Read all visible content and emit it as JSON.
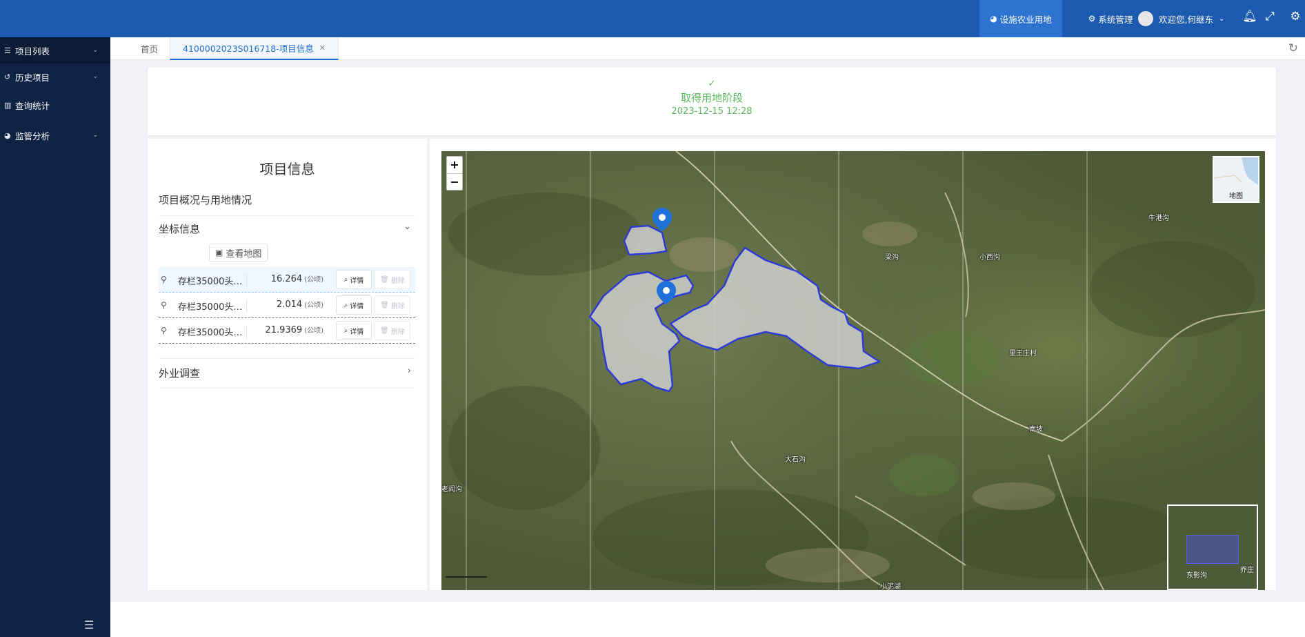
{
  "header": {
    "nav_active": "设施农业用地",
    "nav_system": "系统管理",
    "user_greeting": "欢迎您,何继东"
  },
  "sidebar": {
    "items": [
      {
        "label": "项目列表",
        "icon": "list-icon"
      },
      {
        "label": "历史项目",
        "icon": "history-icon"
      },
      {
        "label": "查询统计",
        "icon": "bar-chart-icon"
      },
      {
        "label": "监管分析",
        "icon": "pie-chart-icon"
      }
    ]
  },
  "tabs": {
    "home": "首页",
    "active": "4100002023S016718-项目信息"
  },
  "stage": {
    "name": "取得用地阶段",
    "time": "2023-12-15 12:28"
  },
  "panel": {
    "title": "项目信息",
    "section_overview": "项目概况与用地情况",
    "section_coords": "坐标信息",
    "map_button": "查看地图",
    "section_field": "外业调查",
    "detail_label": "详情",
    "delete_label": "删除",
    "unit": "(公顷)",
    "rows": [
      {
        "name": "存栏35000头…",
        "area": "16.264"
      },
      {
        "name": "存栏35000头…",
        "area": "2.014"
      },
      {
        "name": "存栏35000头…",
        "area": "21.9369"
      }
    ]
  },
  "map": {
    "zoom_in": "+",
    "zoom_out": "−",
    "layer_label": "地图",
    "places": [
      {
        "name": "牛港沟"
      },
      {
        "name": "梁沟"
      },
      {
        "name": "小西沟"
      },
      {
        "name": "里王庄村"
      },
      {
        "name": "南坡"
      },
      {
        "name": "大石沟"
      },
      {
        "name": "老阎沟"
      },
      {
        "name": "小泥湖"
      }
    ],
    "overview_labels": [
      "东影沟",
      "乔庄"
    ]
  }
}
